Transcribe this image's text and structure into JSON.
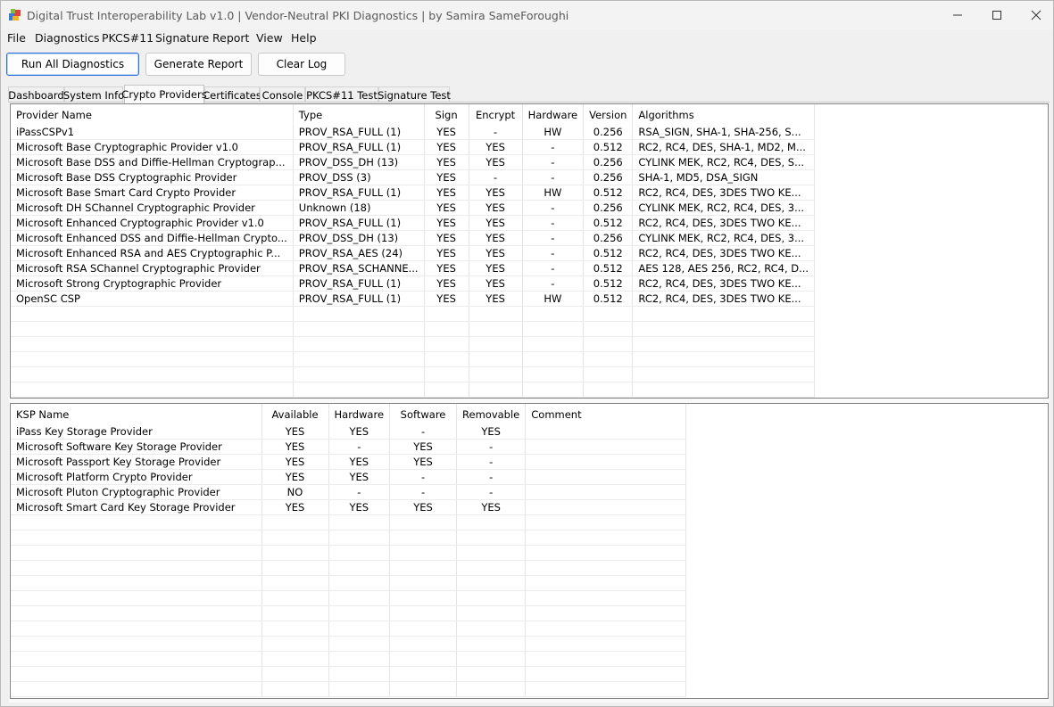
{
  "window": {
    "title": "Digital Trust Interoperability Lab v1.0  |  Vendor-Neutral PKI Diagnostics  |  by Samira SameForoughi"
  },
  "menu": [
    "File",
    "Diagnostics",
    "PKCS#11",
    "Signature",
    "Report",
    "View",
    "Help"
  ],
  "toolbar": {
    "run_all": "Run All Diagnostics",
    "generate_report": "Generate Report",
    "clear_log": "Clear Log"
  },
  "tabs": [
    "Dashboard",
    "System Info",
    "Crypto Providers",
    "Certificates",
    "Console",
    "PKCS#11 Test",
    "Signature Test"
  ],
  "active_tab": "Crypto Providers",
  "providers": {
    "headers": [
      "Provider Name",
      "Type",
      "Sign",
      "Encrypt",
      "Hardware",
      "Version",
      "Algorithms"
    ],
    "rows": [
      [
        "iPassCSPv1",
        "PROV_RSA_FULL (1)",
        "YES",
        "-",
        "HW",
        "0.256",
        "RSA_SIGN, SHA-1, SHA-256, S..."
      ],
      [
        "Microsoft Base Cryptographic Provider v1.0",
        "PROV_RSA_FULL (1)",
        "YES",
        "YES",
        "-",
        "0.512",
        "RC2, RC4, DES, SHA-1, MD2, M..."
      ],
      [
        "Microsoft Base DSS and Diffie-Hellman Cryptograp...",
        "PROV_DSS_DH (13)",
        "YES",
        "YES",
        "-",
        "0.256",
        "CYLINK MEK, RC2, RC4, DES, S..."
      ],
      [
        "Microsoft Base DSS Cryptographic Provider",
        "PROV_DSS (3)",
        "YES",
        "-",
        "-",
        "0.256",
        "SHA-1, MD5, DSA_SIGN"
      ],
      [
        "Microsoft Base Smart Card Crypto Provider",
        "PROV_RSA_FULL (1)",
        "YES",
        "YES",
        "HW",
        "0.512",
        "RC2, RC4, DES, 3DES TWO KE..."
      ],
      [
        "Microsoft DH SChannel Cryptographic Provider",
        "Unknown (18)",
        "YES",
        "YES",
        "-",
        "0.256",
        "CYLINK MEK, RC2, RC4, DES, 3..."
      ],
      [
        "Microsoft Enhanced Cryptographic Provider v1.0",
        "PROV_RSA_FULL (1)",
        "YES",
        "YES",
        "-",
        "0.512",
        "RC2, RC4, DES, 3DES TWO KE..."
      ],
      [
        "Microsoft Enhanced DSS and Diffie-Hellman Crypto...",
        "PROV_DSS_DH (13)",
        "YES",
        "YES",
        "-",
        "0.256",
        "CYLINK MEK, RC2, RC4, DES, 3..."
      ],
      [
        "Microsoft Enhanced RSA and AES Cryptographic P...",
        "PROV_RSA_AES (24)",
        "YES",
        "YES",
        "-",
        "0.512",
        "RC2, RC4, DES, 3DES TWO KE..."
      ],
      [
        "Microsoft RSA SChannel Cryptographic Provider",
        "PROV_RSA_SCHANNE...",
        "YES",
        "YES",
        "-",
        "0.512",
        "AES 128, AES 256, RC2, RC4, D..."
      ],
      [
        "Microsoft Strong Cryptographic Provider",
        "PROV_RSA_FULL (1)",
        "YES",
        "YES",
        "-",
        "0.512",
        "RC2, RC4, DES, 3DES TWO KE..."
      ],
      [
        "OpenSC CSP",
        "PROV_RSA_FULL (1)",
        "YES",
        "YES",
        "HW",
        "0.512",
        "RC2, RC4, DES, 3DES TWO KE..."
      ]
    ]
  },
  "ksp": {
    "headers": [
      "KSP Name",
      "Available",
      "Hardware",
      "Software",
      "Removable",
      "Comment"
    ],
    "rows": [
      [
        "iPass Key Storage Provider",
        "YES",
        "YES",
        "-",
        "YES",
        ""
      ],
      [
        "Microsoft Software Key Storage Provider",
        "YES",
        "-",
        "YES",
        "-",
        ""
      ],
      [
        "Microsoft Passport Key Storage Provider",
        "YES",
        "YES",
        "YES",
        "-",
        ""
      ],
      [
        "Microsoft Platform Crypto Provider",
        "YES",
        "YES",
        "-",
        "-",
        ""
      ],
      [
        "Microsoft Pluton Cryptographic Provider",
        "NO",
        "-",
        "-",
        "-",
        ""
      ],
      [
        "Microsoft Smart Card Key Storage Provider",
        "YES",
        "YES",
        "YES",
        "YES",
        ""
      ]
    ]
  },
  "colors": {
    "accent": "#2f6fd6",
    "grid_border": "#828282",
    "titlebar": "#f3f3f3"
  }
}
